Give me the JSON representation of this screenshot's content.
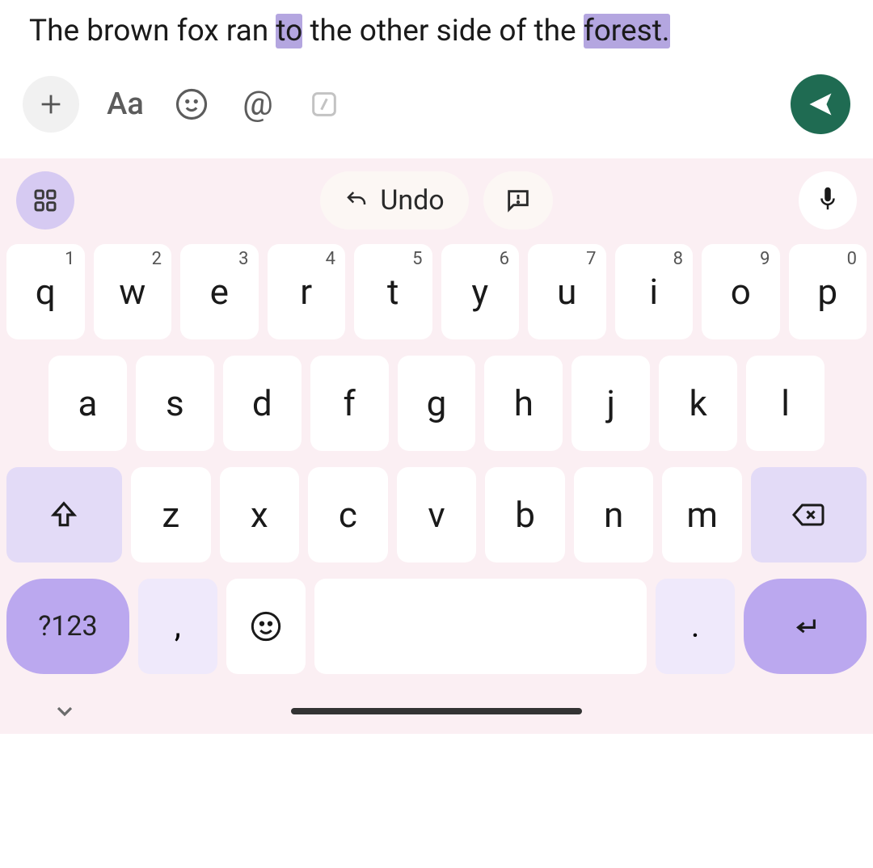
{
  "text": {
    "segments": [
      {
        "t": "The brown fox ran ",
        "hl": false
      },
      {
        "t": "to",
        "hl": true
      },
      {
        "t": " the other side of the ",
        "hl": false
      },
      {
        "t": "forest.",
        "hl": true
      }
    ]
  },
  "compose": {
    "plus": "+",
    "aa": "Aa",
    "at": "@"
  },
  "suggestions": {
    "undo": "Undo"
  },
  "keyboard": {
    "row1": [
      {
        "k": "q",
        "n": "1"
      },
      {
        "k": "w",
        "n": "2"
      },
      {
        "k": "e",
        "n": "3"
      },
      {
        "k": "r",
        "n": "4"
      },
      {
        "k": "t",
        "n": "5"
      },
      {
        "k": "y",
        "n": "6"
      },
      {
        "k": "u",
        "n": "7"
      },
      {
        "k": "i",
        "n": "8"
      },
      {
        "k": "o",
        "n": "9"
      },
      {
        "k": "p",
        "n": "0"
      }
    ],
    "row2": [
      "a",
      "s",
      "d",
      "f",
      "g",
      "h",
      "j",
      "k",
      "l"
    ],
    "row3": [
      "z",
      "x",
      "c",
      "v",
      "b",
      "n",
      "m"
    ],
    "symbols": "?123",
    "comma": ",",
    "period": "."
  },
  "colors": {
    "highlight": "#b4a6e0",
    "keyboardBg": "#fbeff3",
    "accentKey": "#bba8ef",
    "funcKey": "#e3dbf7",
    "send": "#1f6b52"
  }
}
